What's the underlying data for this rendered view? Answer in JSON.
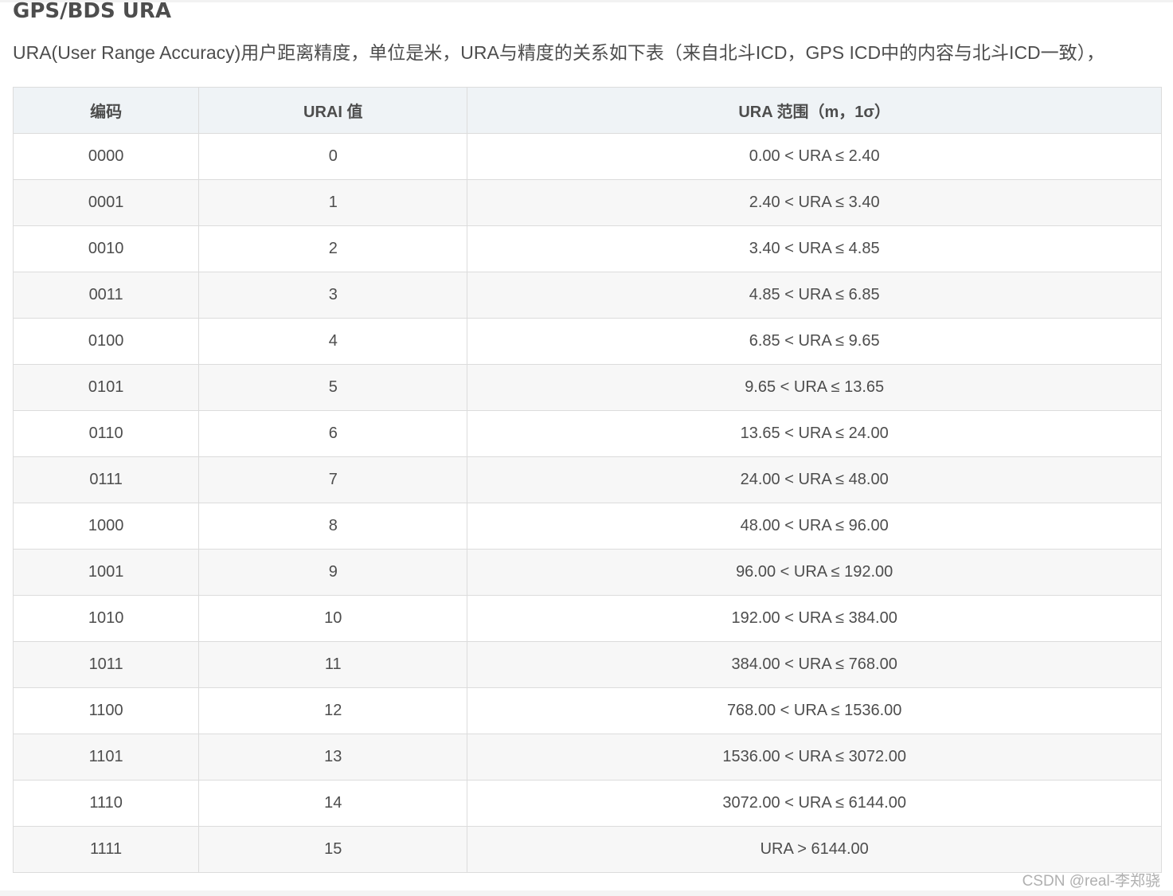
{
  "heading": "GPS/BDS URA",
  "intro": "URA(User Range Accuracy)用户距离精度，单位是米，URA与精度的关系如下表（来自北斗ICD，GPS ICD中的内容与北斗ICD一致），",
  "table": {
    "headers": [
      "编码",
      "URAI 值",
      "URA 范围（m，1σ）"
    ],
    "rows": [
      [
        "0000",
        "0",
        "0.00 < URA ≤ 2.40"
      ],
      [
        "0001",
        "1",
        "2.40 < URA ≤ 3.40"
      ],
      [
        "0010",
        "2",
        "3.40 < URA ≤ 4.85"
      ],
      [
        "0011",
        "3",
        "4.85 < URA ≤ 6.85"
      ],
      [
        "0100",
        "4",
        "6.85 < URA ≤ 9.65"
      ],
      [
        "0101",
        "5",
        "9.65 < URA ≤ 13.65"
      ],
      [
        "0110",
        "6",
        "13.65 < URA ≤ 24.00"
      ],
      [
        "0111",
        "7",
        "24.00 < URA ≤ 48.00"
      ],
      [
        "1000",
        "8",
        "48.00 < URA ≤ 96.00"
      ],
      [
        "1001",
        "9",
        "96.00 < URA ≤ 192.00"
      ],
      [
        "1010",
        "10",
        "192.00 < URA ≤ 384.00"
      ],
      [
        "1011",
        "11",
        "384.00 < URA ≤ 768.00"
      ],
      [
        "1100",
        "12",
        "768.00 < URA ≤ 1536.00"
      ],
      [
        "1101",
        "13",
        "1536.00 < URA ≤ 3072.00"
      ],
      [
        "1110",
        "14",
        "3072.00 < URA ≤ 6144.00"
      ],
      [
        "1111",
        "15",
        "URA > 6144.00"
      ]
    ]
  },
  "watermark": "CSDN @real-李郑骁"
}
